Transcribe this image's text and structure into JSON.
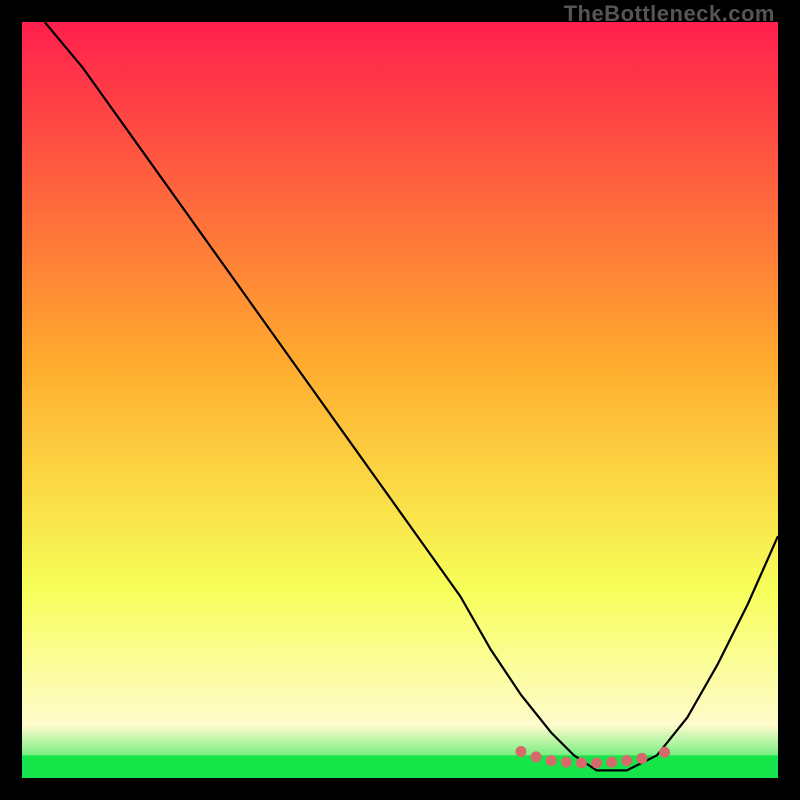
{
  "watermark": "TheBottleneck.com",
  "colors": {
    "bg": "#000000",
    "curve": "#000000",
    "optimal_band": "#16e54a",
    "fade_top": "#fffbcc",
    "dots": "#d66a6a",
    "grad_top": "#ff1f4d",
    "grad_mid": "#ffab2e",
    "grad_low": "#f7ff59",
    "grad_bot": "#16e54a"
  },
  "chart_data": {
    "type": "line",
    "title": "",
    "xlabel": "",
    "ylabel": "",
    "xlim": [
      0,
      100
    ],
    "ylim": [
      0,
      100
    ],
    "x": [
      3,
      8,
      13,
      18,
      23,
      28,
      33,
      38,
      43,
      48,
      53,
      58,
      62,
      66,
      70,
      73,
      76,
      80,
      84,
      88,
      92,
      96,
      100
    ],
    "y": [
      100,
      94,
      87,
      80,
      73,
      66,
      59,
      52,
      45,
      38,
      31,
      24,
      17,
      11,
      6,
      3,
      1,
      1,
      3,
      8,
      15,
      23,
      32
    ],
    "optimal_zone_y": [
      0,
      3
    ],
    "dot_x": [
      66,
      68,
      70,
      72,
      74,
      76,
      78,
      80,
      82,
      85
    ],
    "dot_y": [
      3.5,
      2.8,
      2.3,
      2.1,
      2.0,
      2.0,
      2.1,
      2.3,
      2.6,
      3.4
    ]
  }
}
